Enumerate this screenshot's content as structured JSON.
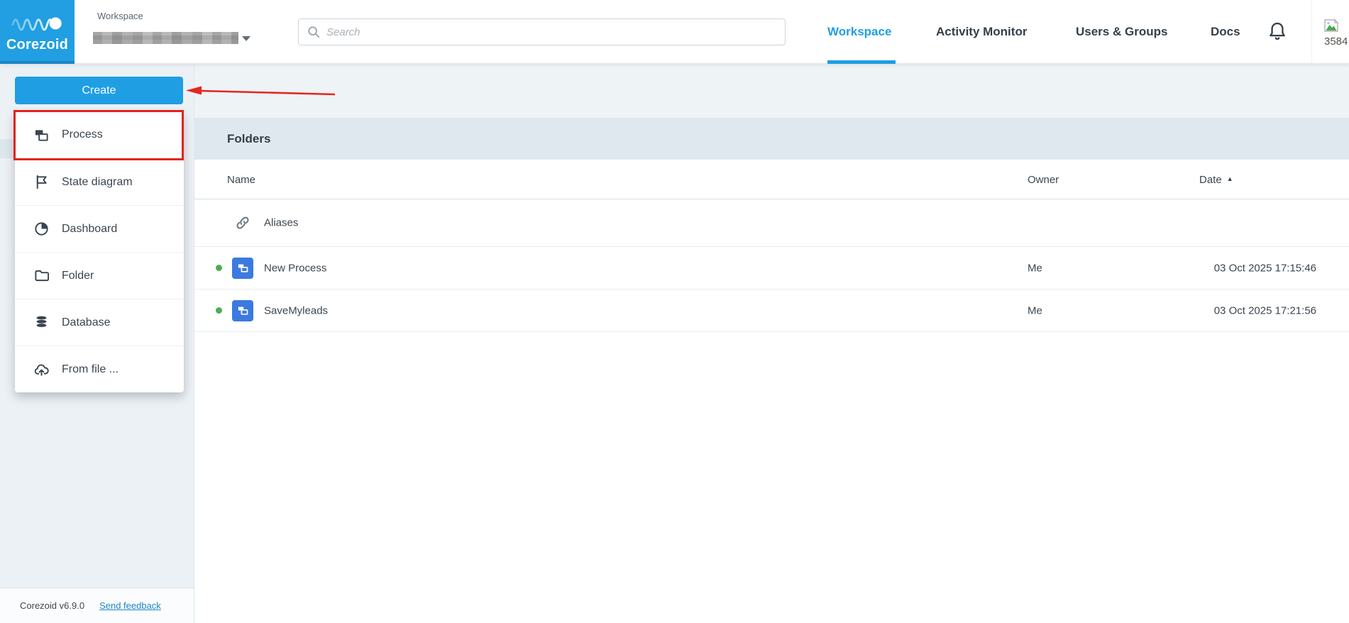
{
  "header": {
    "logo_text": "Corezoid",
    "workspace_label": "Workspace",
    "workspace_name_hidden": true,
    "search": {
      "placeholder": "Search"
    },
    "tabs": [
      {
        "label": "Workspace",
        "active": true
      },
      {
        "label": "Activity Monitor",
        "active": false
      },
      {
        "label": "Users & Groups",
        "active": false
      },
      {
        "label": "Docs",
        "active": false
      }
    ],
    "bell_icon": "bell-icon",
    "avatar_alt_text": "3584"
  },
  "sidebar": {
    "create_label": "Create",
    "menu_items": [
      {
        "label": "Process",
        "icon": "process-icon",
        "highlighted": true
      },
      {
        "label": "State diagram",
        "icon": "flag-icon",
        "highlighted": false
      },
      {
        "label": "Dashboard",
        "icon": "pie-chart-icon",
        "highlighted": false
      },
      {
        "label": "Folder",
        "icon": "folder-icon",
        "highlighted": false
      },
      {
        "label": "Database",
        "icon": "database-icon",
        "highlighted": false
      },
      {
        "label": "From file ...",
        "icon": "cloud-upload-icon",
        "highlighted": false
      }
    ],
    "footer": {
      "version": "Corezoid v6.9.0",
      "feedback_link": "Send feedback"
    }
  },
  "annotations": {
    "arrow_color": "#e8251f",
    "highlight_box_color": "#e1241b",
    "arrow_target": "Create button",
    "box_target": "Process menu item"
  },
  "main": {
    "panel_title": "Folders",
    "table": {
      "columns": {
        "name": "Name",
        "owner": "Owner",
        "date": "Date"
      },
      "sort": {
        "column": "Date",
        "direction": "asc",
        "glyph": "▲"
      },
      "rows": [
        {
          "name": "Aliases",
          "icon": "link-icon",
          "status": null,
          "owner": "",
          "date": ""
        },
        {
          "name": "New Process",
          "icon": "process-badge-icon",
          "status": "active",
          "owner": "Me",
          "date": "03 Oct 2025 17:15:46"
        },
        {
          "name": "SaveMyleads",
          "icon": "process-badge-icon",
          "status": "active",
          "owner": "Me",
          "date": "03 Oct 2025 17:21:56"
        }
      ]
    }
  },
  "colors": {
    "brand_blue": "#1f9ee4",
    "active_tab_blue": "#1f9ee1",
    "annotation_red": "#e1241b",
    "status_green": "#4cae4f",
    "process_badge_blue": "#3b7ae0",
    "sidebar_bg": "#ecf1f5",
    "panel_header_bg": "#dfe8ef"
  }
}
